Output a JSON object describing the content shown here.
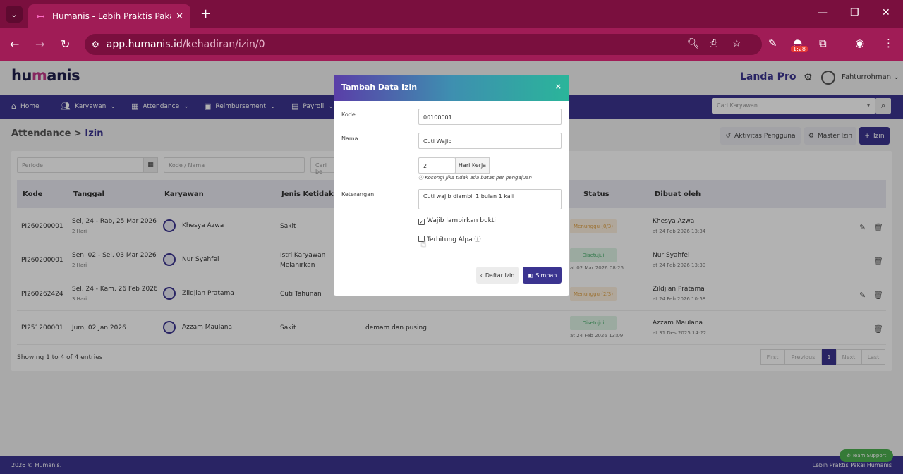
{
  "browser": {
    "tab_title": "Humanis - Lebih Praktis Pakai H",
    "url_host": "app.humanis.id",
    "url_path": "/kehadiran/izin/0",
    "ext_badge": "1:28"
  },
  "header": {
    "logo_a": "hu",
    "logo_b": "m",
    "logo_c": "anis",
    "plan": "Landa Pro",
    "user": "Fahturrohman"
  },
  "nav": {
    "items": [
      "Home",
      "Karyawan",
      "Attendance",
      "Reimbursement",
      "Payroll"
    ],
    "search_placeholder": "Cari Karyawan"
  },
  "breadcrumb": {
    "parent": "Attendance",
    "sep": ">",
    "current": "Izin"
  },
  "toolbar": {
    "activity": "Aktivitas Pengguna",
    "master": "Master Izin",
    "add": "Izin"
  },
  "filters": {
    "period": "Periode",
    "code_name": "Kode / Nama",
    "search": "Cari be"
  },
  "table": {
    "headers": [
      "Kode",
      "Tanggal",
      "Karyawan",
      "Jenis KetidakHa",
      "Status",
      "Dibuat oleh"
    ],
    "rows": [
      {
        "code": "PI260200001",
        "date": "Sel, 24 - Rab, 25 Mar 2026",
        "days": "2 Hari",
        "employee": "Khesya Azwa",
        "type": "Sakit",
        "type2": "",
        "status": "Menunggu (0/3)",
        "status_date": "",
        "creator": "Khesya Azwa",
        "created": "at 24 Feb 2026 13:34"
      },
      {
        "code": "PI260200001",
        "date": "Sen, 02 - Sel, 03 Mar 2026",
        "days": "2 Hari",
        "employee": "Nur Syahfei",
        "type": "Istri Karyawan",
        "type2": "Melahirkan",
        "status": "Disetujui",
        "status_date": "at 02 Mar 2026 08:25",
        "creator": "Nur Syahfei",
        "created": "at 24 Feb 2026 13:30"
      },
      {
        "code": "PI260262424",
        "date": "Sel, 24 - Kam, 26 Feb 2026",
        "days": "3 Hari",
        "employee": "Zildjian Pratama",
        "type": "Cuti Tahunan",
        "type2": "",
        "status": "Menunggu (2/3)",
        "status_date": "",
        "creator": "Zildjian Pratama",
        "created": "at 24 Feb 2026 10:58"
      },
      {
        "code": "PI251200001",
        "date": "Jum, 02 Jan 2026",
        "days": "",
        "employee": "Azzam Maulana",
        "type": "Sakit",
        "type2": "",
        "status": "Disetujui",
        "status_date": "at 24 Feb 2026 13:09",
        "creator": "Azzam Maulana",
        "created": "at 31 Des 2025 14:22",
        "note": "demam dan pusing"
      }
    ]
  },
  "showing": "Showing 1 to 4 of 4 entries",
  "pagination": [
    "First",
    "Previous",
    "1",
    "Next",
    "Last"
  ],
  "footer": {
    "left": "2026 © Humanis.",
    "right": "Lebih Praktis Pakai Humanis",
    "support": "Team Support"
  },
  "modal": {
    "title": "Tambah Data Izin",
    "close": "×",
    "kode_label": "Kode",
    "kode_value": "00100001",
    "nama_label": "Nama",
    "nama_value": "Cuti Wajib",
    "hari_value": "2",
    "hari_addon": "Hari Kerja",
    "hint": "Kosongi Jika tidak ada batas per pengajuan",
    "ket_label": "Keterangan",
    "ket_value": "Cuti wajib diambil 1 bulan 1 kali",
    "bukti_label": "Wajib lampirkan bukti",
    "alpa_label": "Terhitung Alpa",
    "back_btn": "Daftar Izin",
    "save_btn": "Simpan"
  },
  "colors": {
    "brand": "#3b3490",
    "chrome": "#a01c56"
  }
}
